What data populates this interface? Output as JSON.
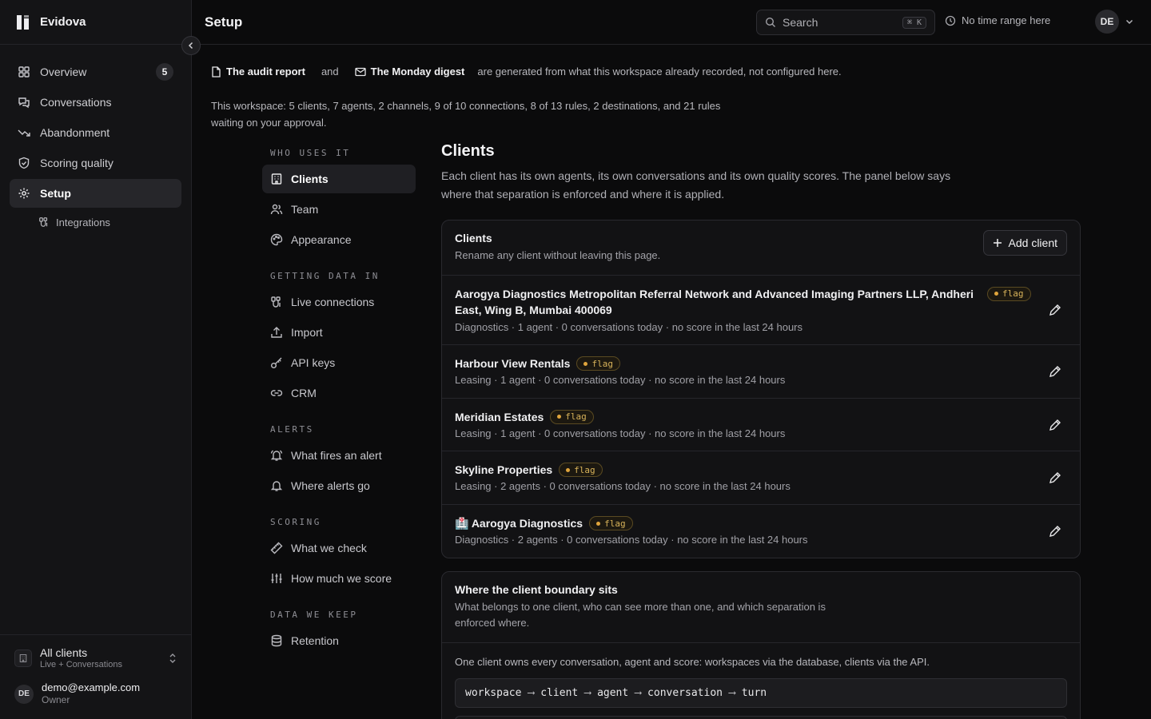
{
  "app": {
    "name": "Evidova"
  },
  "sidebar": {
    "items": [
      {
        "label": "Overview",
        "icon": "grid-icon",
        "badge": "5"
      },
      {
        "label": "Conversations",
        "icon": "chat-icon"
      },
      {
        "label": "Abandonment",
        "icon": "trend-down-icon"
      },
      {
        "label": "Scoring quality",
        "icon": "shield-check-icon"
      },
      {
        "label": "Setup",
        "icon": "gear-icon",
        "active": true
      }
    ],
    "sub_items": [
      {
        "label": "Integrations",
        "icon": "plug-icon"
      }
    ],
    "client_switcher": {
      "title": "All clients",
      "subtitle": "Live + Conversations"
    },
    "user": {
      "initials": "DE",
      "email": "demo@example.com",
      "role": "Owner"
    }
  },
  "header": {
    "title": "Setup",
    "search": {
      "placeholder": "Search",
      "shortcut": "⌘ K"
    },
    "time_range": "No time range here",
    "avatar_initials": "DE"
  },
  "notice": {
    "link1": "The audit report",
    "and": "and",
    "link2": "The Monday digest",
    "tail": "are generated from what this workspace already recorded, not configured here."
  },
  "summary": "This workspace: 5 clients, 7 agents, 2 channels, 9 of 10 connections, 8 of 13 rules, 2 destinations, and 21 rules waiting on your approval.",
  "subnav": {
    "sections": [
      {
        "heading": "WHO USES IT",
        "items": [
          {
            "label": "Clients",
            "icon": "building-icon",
            "active": true
          },
          {
            "label": "Team",
            "icon": "users-icon"
          },
          {
            "label": "Appearance",
            "icon": "palette-icon"
          }
        ]
      },
      {
        "heading": "GETTING DATA IN",
        "items": [
          {
            "label": "Live connections",
            "icon": "plug-icon"
          },
          {
            "label": "Import",
            "icon": "upload-icon"
          },
          {
            "label": "API keys",
            "icon": "key-icon"
          },
          {
            "label": "CRM",
            "icon": "link-icon"
          }
        ]
      },
      {
        "heading": "ALERTS",
        "items": [
          {
            "label": "What fires an alert",
            "icon": "bell-ring-icon"
          },
          {
            "label": "Where alerts go",
            "icon": "bell-icon"
          }
        ]
      },
      {
        "heading": "SCORING",
        "items": [
          {
            "label": "What we check",
            "icon": "ruler-icon"
          },
          {
            "label": "How much we score",
            "icon": "sliders-icon"
          }
        ]
      },
      {
        "heading": "DATA WE KEEP",
        "items": [
          {
            "label": "Retention",
            "icon": "database-icon"
          }
        ]
      }
    ]
  },
  "main": {
    "title": "Clients",
    "description": "Each client has its own agents, its own conversations and its own quality scores. The panel below says where that separation is enforced and where it is applied.",
    "clients_card": {
      "title": "Clients",
      "subtitle": "Rename any client without leaving this page.",
      "add_label": "Add client",
      "flag_label": "flag",
      "rows": [
        {
          "name": "Aarogya Diagnostics Metropolitan Referral Network and Advanced Imaging Partners LLP, Andheri East, Wing B, Mumbai 400069",
          "meta": "Diagnostics · 1 agent · 0 conversations today · no score in the last 24 hours"
        },
        {
          "name": "Harbour View Rentals",
          "meta": "Leasing · 1 agent · 0 conversations today · no score in the last 24 hours"
        },
        {
          "name": "Meridian Estates",
          "meta": "Leasing · 1 agent · 0 conversations today · no score in the last 24 hours"
        },
        {
          "name": "Skyline Properties",
          "meta": "Leasing · 2 agents · 0 conversations today · no score in the last 24 hours"
        },
        {
          "name": "Aarogya Diagnostics",
          "emoji": "🏥",
          "meta": "Diagnostics · 2 agents · 0 conversations today · no score in the last 24 hours"
        }
      ]
    },
    "boundary_card": {
      "title": "Where the client boundary sits",
      "subtitle": "What belongs to one client, who can see more than one, and which separation is enforced where.",
      "text": "One client owns every conversation, agent and score: workspaces via the database, clients via the API.",
      "chain": [
        "workspace",
        "client",
        "agent",
        "conversation",
        "turn"
      ],
      "arrow": "⟶"
    }
  }
}
